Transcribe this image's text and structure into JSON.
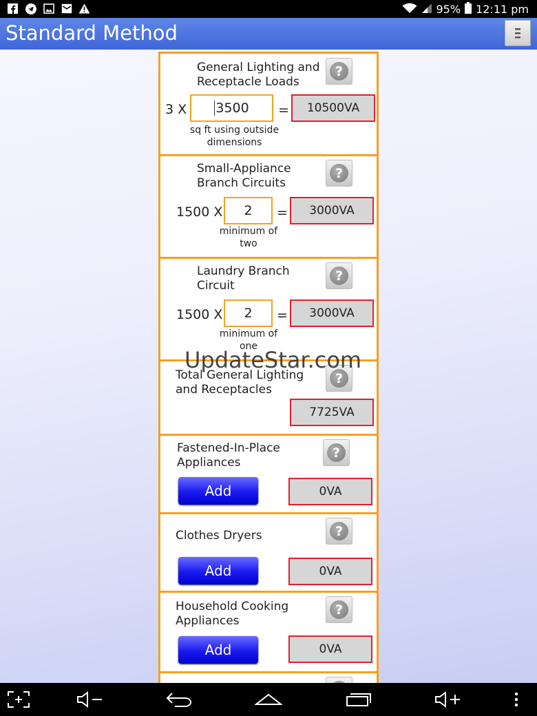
{
  "status_bar": {
    "icons": [
      "facebook-icon",
      "telegram-icon",
      "image-icon",
      "mail-icon",
      "warning-icon"
    ],
    "battery": "95%",
    "time": "12:11 pm"
  },
  "app": {
    "title": "Standard Method"
  },
  "watermark": "UpdateStar.com",
  "sections": {
    "general": {
      "label1": "General Lighting and",
      "label2": "Receptacle Loads",
      "multiplier": "3 X",
      "input_value": "3500",
      "equals": "=",
      "result": "10500VA",
      "note1": "sq ft using outside",
      "note2": "dimensions"
    },
    "small_appliance": {
      "label1": "Small-Appliance",
      "label2": "Branch Circuits",
      "multiplier": "1500 X",
      "input_value": "2",
      "equals": "=",
      "result": "3000VA",
      "note1": "minimum of",
      "note2": "two"
    },
    "laundry": {
      "label1": "Laundry Branch",
      "label2": "Circuit",
      "multiplier": "1500 X",
      "input_value": "2",
      "equals": "=",
      "result": "3000VA",
      "note1": "minimum of",
      "note2": "one"
    },
    "total": {
      "label1": "Total General Lighting",
      "label2": "and Receptacles",
      "result": "7725VA"
    },
    "fastened": {
      "label1": "Fastened-In-Place",
      "label2": "Appliances",
      "add_label": "Add",
      "result": "0VA"
    },
    "dryers": {
      "label1": "Clothes Dryers",
      "add_label": "Add",
      "result": "0VA"
    },
    "cooking": {
      "label1": "Household Cooking",
      "label2": "Appliances",
      "add_label": "Add",
      "result": "0VA"
    }
  },
  "help_symbol": "?",
  "nav_icons": [
    "screenshot-icon",
    "volume-down-icon",
    "back-icon",
    "home-icon",
    "recent-apps-icon",
    "volume-up-icon",
    "more-icon"
  ],
  "colors": {
    "accent_orange": "#f5a020",
    "result_red": "#e0202e",
    "add_blue": "#1a1af0",
    "action_bar": "#4a72e0"
  }
}
